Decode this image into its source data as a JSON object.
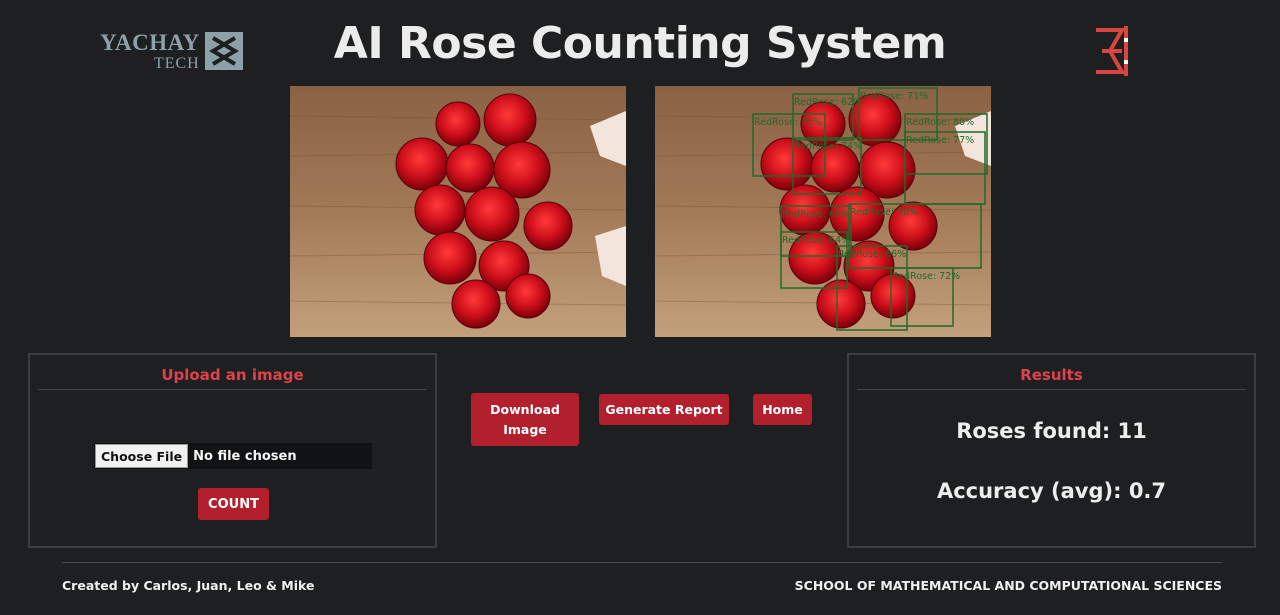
{
  "header": {
    "title": "AI Rose Counting System",
    "logo_left_line1": "YACHAY",
    "logo_left_line2": "TECH"
  },
  "images": {
    "detections": [
      {
        "label": "RedRose: 62%"
      },
      {
        "label": "RedRose: 71%"
      },
      {
        "label": "RedRose: 75%"
      },
      {
        "label": "RedRose: 80%"
      },
      {
        "label": "RedRose: 74%"
      },
      {
        "label": "RedRose: 77%"
      },
      {
        "label": "RedRose: 69%"
      },
      {
        "label": "RedRose: 64%"
      },
      {
        "label": "RedRose: 70%"
      },
      {
        "label": "RedRose: 66%"
      },
      {
        "label": "RedRose: 72%"
      }
    ]
  },
  "upload": {
    "heading": "Upload an image",
    "choose_file_label": "Choose File",
    "file_status": "No file chosen",
    "count_label": "COUNT"
  },
  "actions": {
    "download_label": "Download Image",
    "report_label": "Generate Report",
    "home_label": "Home"
  },
  "results": {
    "heading": "Results",
    "roses_found": "Roses found: 11",
    "accuracy": "Accuracy (avg): 0.7"
  },
  "footer": {
    "credits": "Created by Carlos, Juan, Leo & Mike",
    "school": "SCHOOL OF MATHEMATICAL AND COMPUTATIONAL SCIENCES"
  },
  "colors": {
    "background": "#1e1f21",
    "accent_red": "#b21f2d",
    "heading_red": "#e0424c",
    "detection_green": "#1e6a2a"
  }
}
